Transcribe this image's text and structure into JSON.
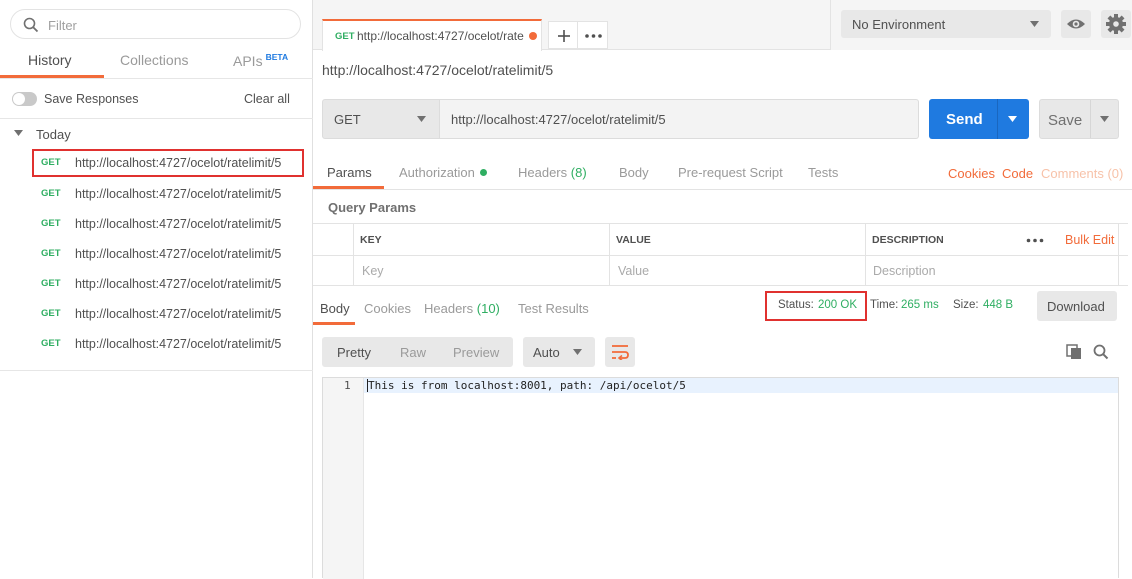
{
  "sidebar": {
    "filter_placeholder": "Filter",
    "tabs": {
      "history": "History",
      "collections": "Collections",
      "apis": "APIs",
      "apis_badge": "BETA"
    },
    "save_responses": "Save Responses",
    "clear_all": "Clear all",
    "group": "Today",
    "history": [
      {
        "method": "GET",
        "url": "http://localhost:4727/ocelot/ratelimit/5"
      },
      {
        "method": "GET",
        "url": "http://localhost:4727/ocelot/ratelimit/5"
      },
      {
        "method": "GET",
        "url": "http://localhost:4727/ocelot/ratelimit/5"
      },
      {
        "method": "GET",
        "url": "http://localhost:4727/ocelot/ratelimit/5"
      },
      {
        "method": "GET",
        "url": "http://localhost:4727/ocelot/ratelimit/5"
      },
      {
        "method": "GET",
        "url": "http://localhost:4727/ocelot/ratelimit/5"
      },
      {
        "method": "GET",
        "url": "http://localhost:4727/ocelot/ratelimit/5"
      }
    ]
  },
  "tabbar": {
    "tab_method": "GET",
    "tab_url": "http://localhost:4727/ocelot/rate",
    "environment": "No Environment"
  },
  "request": {
    "title": "http://localhost:4727/ocelot/ratelimit/5",
    "method": "GET",
    "url": "http://localhost:4727/ocelot/ratelimit/5",
    "send": "Send",
    "save": "Save",
    "tabs": {
      "params": "Params",
      "authorization": "Authorization",
      "headers": "Headers",
      "headers_count": "(8)",
      "body": "Body",
      "prerequest": "Pre-request Script",
      "tests": "Tests"
    },
    "links": {
      "cookies": "Cookies",
      "code": "Code",
      "comments": "Comments (0)"
    },
    "query_params_title": "Query Params",
    "table": {
      "col_key": "KEY",
      "col_value": "VALUE",
      "col_description": "DESCRIPTION",
      "bulk_edit": "Bulk Edit",
      "ph_key": "Key",
      "ph_value": "Value",
      "ph_description": "Description"
    }
  },
  "response": {
    "tabs": {
      "body": "Body",
      "cookies": "Cookies",
      "headers": "Headers",
      "headers_count": "(10)",
      "test_results": "Test Results"
    },
    "status_label": "Status:",
    "status_value": "200 OK",
    "time_label": "Time:",
    "time_value": "265 ms",
    "size_label": "Size:",
    "size_value": "448 B",
    "download": "Download",
    "formats": {
      "pretty": "Pretty",
      "raw": "Raw",
      "preview": "Preview"
    },
    "language": "Auto",
    "line_number": "1",
    "body_text": "This is from localhost:8001, path: /api/ocelot/5"
  },
  "colors": {
    "accent": "#f26b3a",
    "send_blue": "#1f7ae0",
    "success_green": "#2fae62",
    "highlight_red": "#e0312f"
  }
}
